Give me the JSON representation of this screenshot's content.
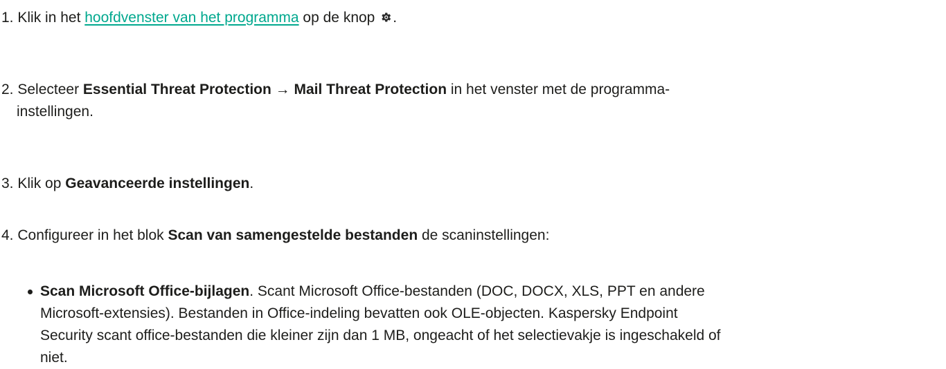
{
  "steps": [
    {
      "number": "1.",
      "pre": "Klik in het ",
      "link": "hoofdvenster van het programma",
      "post1": " op de knop ",
      "icon": "gear-icon",
      "post2": "."
    },
    {
      "number": "2.",
      "pre": "Selecteer ",
      "bold1": "Essential Threat Protection",
      "arrow": " → ",
      "bold2": "Mail Threat Protection",
      "post": " in het venster met de programma-",
      "post_line2": "instellingen."
    },
    {
      "number": "3.",
      "pre": "Klik op ",
      "bold": "Geavanceerde instellingen",
      "post": "."
    },
    {
      "number": "4.",
      "pre": "Configureer in het blok ",
      "bold": "Scan van samengestelde bestanden",
      "post": " de scaninstellingen:"
    }
  ],
  "bullet": {
    "bold": "Scan Microsoft Office-bijlagen",
    "lines": [
      ". Scant Microsoft Office-bestanden (DOC, DOCX, XLS, PPT en andere",
      "Microsoft-extensies). Bestanden in Office-indeling bevatten ook OLE-objecten. Kaspersky Endpoint",
      "Security scant office-bestanden die kleiner zijn dan 1 MB, ongeacht of het selectievakje is ingeschakeld of",
      "niet."
    ]
  },
  "colors": {
    "text": "#1d1d1b",
    "link": "#00a88e"
  }
}
